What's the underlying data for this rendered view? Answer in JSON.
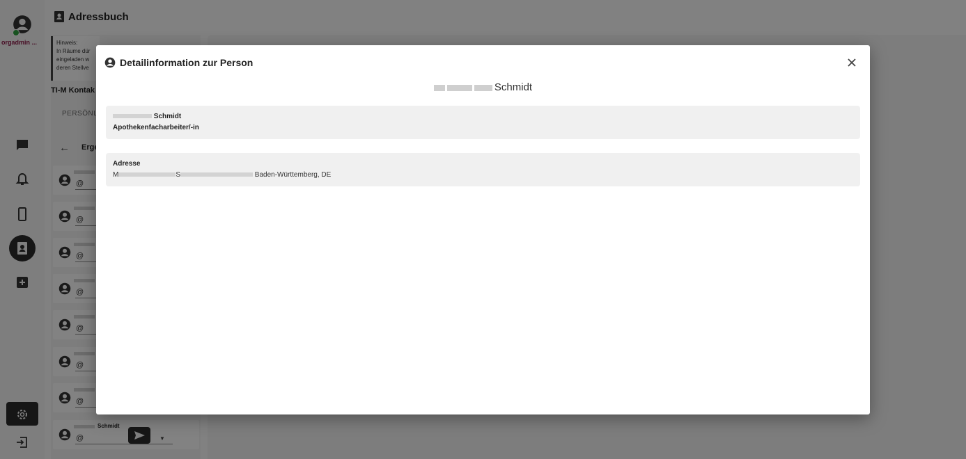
{
  "app": {
    "user_name": "orgadmin ...",
    "page_title": "Adressbuch",
    "hint_label": "Hinweis:",
    "hint_text": "In Räume dür eingeladen w deren Stellve",
    "tim_label": "TI-M Kontak",
    "tab_personal": "PERSÖNLI ADRESSB",
    "results_label": "Erge",
    "at_symbol": "@",
    "last_contact_name": "Schmidt"
  },
  "dialog": {
    "title": "Detailinformation zur Person",
    "person_name": "Schmidt",
    "name_line": "Schmidt",
    "profession": "Apothekenfacharbeiter/-in",
    "address_label": "Adresse",
    "address_prefix": "M",
    "address_mid": "S",
    "address_region": "Baden-Württemberg, DE"
  },
  "colors": {
    "overlay": "#000000",
    "dark_button": "#2b2b2b",
    "user_name": "#8b1e4a",
    "online": "#2e9e3f"
  }
}
